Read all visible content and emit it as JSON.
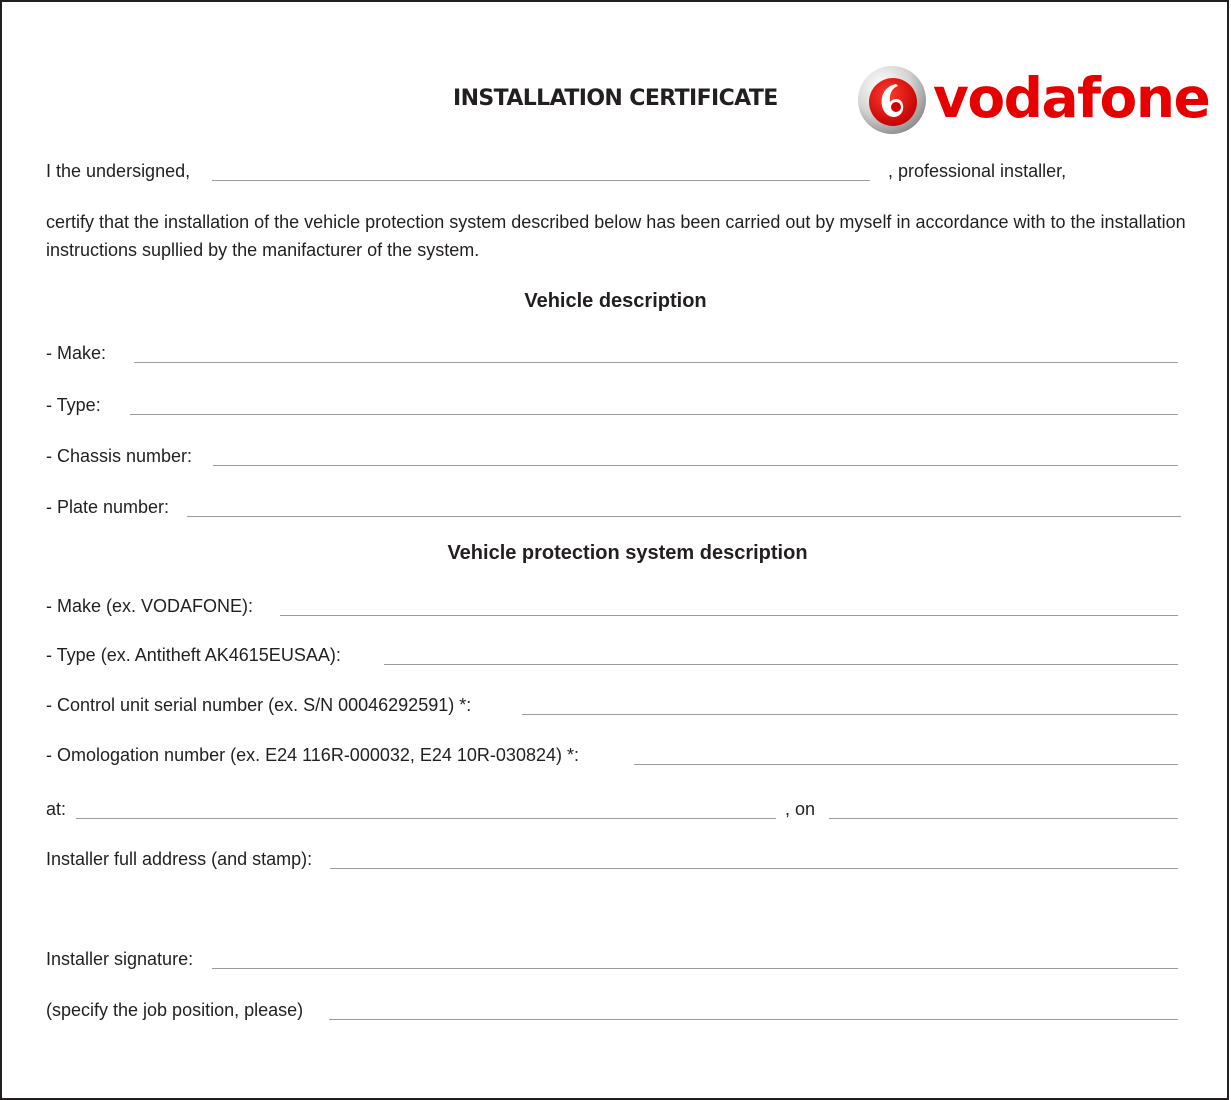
{
  "header": {
    "title": "INSTALLATION CERTIFICATE",
    "logo_text": "vodafone",
    "brand_color": "#e60000",
    "logo_icon": "vodafone-speechmark-icon"
  },
  "intro": {
    "undersigned_label": "I the undersigned,",
    "installer_suffix": ", professional installer,",
    "certify_text": "certify that the installation of the vehicle protection system described below has been carried out by myself in accordance with to the installation instructions supllied by the manifacturer of the system."
  },
  "vehicle": {
    "heading": "Vehicle description",
    "make_label": "- Make:",
    "type_label": "- Type:",
    "chassis_label": "- Chassis number:",
    "plate_label": "- Plate number:"
  },
  "protection": {
    "heading": "Vehicle protection system description",
    "make_label": "- Make (ex. VODAFONE):",
    "type_label": "- Type (ex. Antitheft AK4615EUSAA):",
    "serial_label": "- Control unit serial number (ex. S/N 00046292591) *:",
    "omologation_label": "- Omologation number (ex. E24 116R-000032, E24 10R-030824) *:"
  },
  "footer": {
    "at_label": "at:",
    "on_label": ", on",
    "address_label": "Installer full address (and stamp):",
    "signature_label": "Installer signature:",
    "job_position_label": "(specify the job position, please)"
  }
}
